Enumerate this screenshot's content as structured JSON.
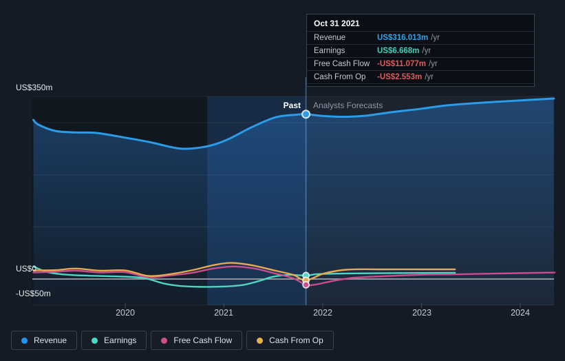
{
  "tooltip": {
    "date": "Oct 31 2021",
    "rows": [
      {
        "label": "Revenue",
        "value": "US$316.013m",
        "suffix": "/yr",
        "color": "#36a2e8"
      },
      {
        "label": "Earnings",
        "value": "US$6.668m",
        "suffix": "/yr",
        "color": "#3fd0bc"
      },
      {
        "label": "Free Cash Flow",
        "value": "-US$11.077m",
        "suffix": "/yr",
        "color": "#e35b5b"
      },
      {
        "label": "Cash From Op",
        "value": "-US$2.553m",
        "suffix": "/yr",
        "color": "#e35b5b"
      }
    ]
  },
  "y_axis": {
    "labels": [
      {
        "text": "US$350m",
        "value": 350
      },
      {
        "text": "US$0",
        "value": 0
      },
      {
        "text": "-US$50m",
        "value": -50
      }
    ]
  },
  "x_axis": {
    "labels": [
      "2020",
      "2021",
      "2022",
      "2023",
      "2024"
    ]
  },
  "annotations": {
    "past": "Past",
    "forecast": "Analysts Forecasts"
  },
  "legend": [
    {
      "label": "Revenue",
      "color": "#2196f3"
    },
    {
      "label": "Earnings",
      "color": "#4fd8c4"
    },
    {
      "label": "Free Cash Flow",
      "color": "#cf4f8e"
    },
    {
      "label": "Cash From Op",
      "color": "#e8b04f"
    }
  ],
  "chart_data": {
    "type": "line",
    "title": "",
    "y_unit": "US$ millions per year",
    "x_unit": "year (fractional)",
    "xlim": [
      2019.06,
      2024.35
    ],
    "ylim": [
      -50,
      350
    ],
    "x_ticks": [
      2020,
      2021,
      2022,
      2023,
      2024
    ],
    "y_gridlines": [
      350,
      300,
      200,
      100,
      0,
      -50
    ],
    "divider": {
      "x": 2021.83,
      "label_left": "Past",
      "label_right": "Analysts Forecasts"
    },
    "highlight_band": {
      "from": 2020.83,
      "to": 2021.83
    },
    "series": [
      {
        "name": "Revenue",
        "color": "#2b9ce8",
        "width": 3,
        "area": true,
        "points": [
          [
            2019.07,
            305
          ],
          [
            2019.12,
            296
          ],
          [
            2019.29,
            284
          ],
          [
            2019.5,
            281
          ],
          [
            2019.71,
            280
          ],
          [
            2020.0,
            271
          ],
          [
            2020.26,
            262
          ],
          [
            2020.56,
            250
          ],
          [
            2020.82,
            254
          ],
          [
            2021.03,
            267
          ],
          [
            2021.28,
            291
          ],
          [
            2021.52,
            310
          ],
          [
            2021.73,
            315
          ],
          [
            2021.83,
            316.013
          ],
          [
            2022.01,
            312.5
          ],
          [
            2022.22,
            311
          ],
          [
            2022.43,
            313
          ],
          [
            2022.7,
            320
          ],
          [
            2022.98,
            326
          ],
          [
            2023.26,
            333
          ],
          [
            2023.61,
            338
          ],
          [
            2023.96,
            342
          ],
          [
            2024.34,
            346
          ]
        ]
      },
      {
        "name": "Earnings",
        "color": "#50d5c2",
        "width": 2.4,
        "area": false,
        "points": [
          [
            2019.07,
            24
          ],
          [
            2019.22,
            13
          ],
          [
            2019.43,
            8
          ],
          [
            2019.71,
            6
          ],
          [
            2020.0,
            4.5
          ],
          [
            2020.2,
            1.5
          ],
          [
            2020.4,
            -9
          ],
          [
            2020.61,
            -14
          ],
          [
            2020.89,
            -15
          ],
          [
            2021.17,
            -12
          ],
          [
            2021.35,
            -4
          ],
          [
            2021.49,
            4
          ],
          [
            2021.66,
            8
          ],
          [
            2021.83,
            6.668
          ],
          [
            2021.95,
            9.5
          ],
          [
            2022.2,
            10.5
          ],
          [
            2022.8,
            11.5
          ],
          [
            2023.34,
            12
          ]
        ]
      },
      {
        "name": "Free Cash Flow",
        "color": "#cb4d8c",
        "width": 2.4,
        "area": false,
        "points": [
          [
            2019.07,
            12.5
          ],
          [
            2019.29,
            14
          ],
          [
            2019.5,
            16
          ],
          [
            2019.74,
            12.5
          ],
          [
            2020.0,
            13
          ],
          [
            2020.23,
            3.5
          ],
          [
            2020.44,
            6.5
          ],
          [
            2020.68,
            12
          ],
          [
            2020.89,
            20
          ],
          [
            2021.1,
            24
          ],
          [
            2021.31,
            20
          ],
          [
            2021.52,
            10.5
          ],
          [
            2021.7,
            1.5
          ],
          [
            2021.83,
            -11.077
          ],
          [
            2021.93,
            -10.5
          ],
          [
            2022.07,
            -5
          ],
          [
            2022.29,
            2
          ],
          [
            2022.63,
            5.5
          ],
          [
            2023.05,
            8.5
          ],
          [
            2023.34,
            9
          ],
          [
            2023.75,
            10.5
          ],
          [
            2024.35,
            12.5
          ]
        ]
      },
      {
        "name": "Cash From Op",
        "color": "#e5ab51",
        "width": 2.4,
        "area": false,
        "points": [
          [
            2019.07,
            16.5
          ],
          [
            2019.29,
            17
          ],
          [
            2019.5,
            20
          ],
          [
            2019.74,
            16
          ],
          [
            2020.0,
            16.5
          ],
          [
            2020.23,
            6
          ],
          [
            2020.44,
            9
          ],
          [
            2020.68,
            17
          ],
          [
            2020.89,
            26.5
          ],
          [
            2021.07,
            31
          ],
          [
            2021.28,
            26.5
          ],
          [
            2021.52,
            16
          ],
          [
            2021.7,
            8
          ],
          [
            2021.83,
            -2.553
          ],
          [
            2022.01,
            10.5
          ],
          [
            2022.25,
            18
          ],
          [
            2022.63,
            18.5
          ],
          [
            2023.05,
            18.5
          ],
          [
            2023.34,
            18.5
          ]
        ]
      }
    ],
    "markers": [
      {
        "series": "Revenue",
        "x": 2021.83,
        "y": 316.013,
        "r": 5.5
      },
      {
        "series": "Earnings",
        "x": 2021.83,
        "y": 6.668,
        "r": 4.5
      },
      {
        "series": "Cash From Op",
        "x": 2021.83,
        "y": -2.553,
        "r": 4.5
      },
      {
        "series": "Free Cash Flow",
        "x": 2021.83,
        "y": -11.077,
        "r": 4.5
      }
    ]
  }
}
